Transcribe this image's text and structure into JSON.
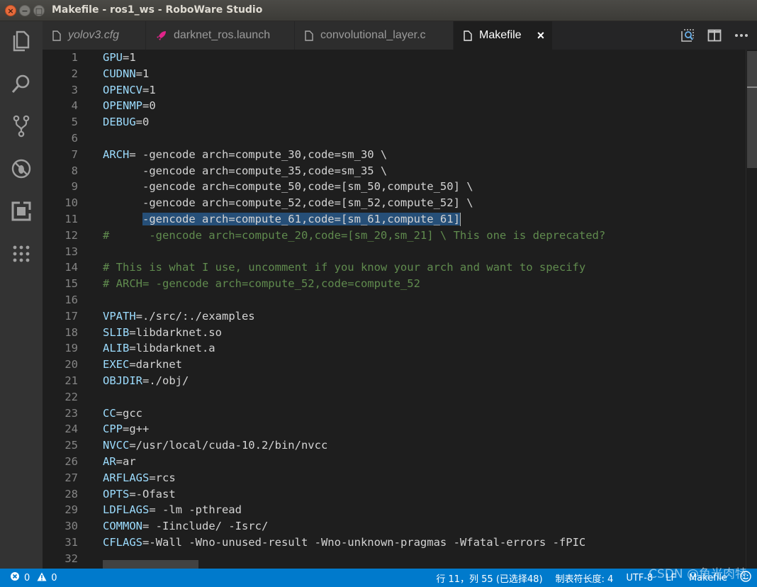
{
  "window": {
    "title": "Makefile - ros1_ws - RoboWare Studio"
  },
  "tabs": [
    {
      "label": "yolov3.cfg",
      "icon": "file-icon",
      "italic": true
    },
    {
      "label": "darknet_ros.launch",
      "icon": "rocket-icon",
      "italic": false
    },
    {
      "label": "convolutional_layer.c",
      "icon": "file-icon",
      "italic": false
    },
    {
      "label": "Makefile",
      "icon": "file-icon",
      "italic": false,
      "active": true
    }
  ],
  "tab_close": "×",
  "code": [
    {
      "n": "1",
      "t": [
        [
          "var",
          "GPU"
        ],
        [
          "txt",
          "=1"
        ]
      ]
    },
    {
      "n": "2",
      "t": [
        [
          "var",
          "CUDNN"
        ],
        [
          "txt",
          "=1"
        ]
      ]
    },
    {
      "n": "3",
      "t": [
        [
          "var",
          "OPENCV"
        ],
        [
          "txt",
          "=1"
        ]
      ]
    },
    {
      "n": "4",
      "t": [
        [
          "var",
          "OPENMP"
        ],
        [
          "txt",
          "=0"
        ]
      ]
    },
    {
      "n": "5",
      "t": [
        [
          "var",
          "DEBUG"
        ],
        [
          "txt",
          "=0"
        ]
      ]
    },
    {
      "n": "6",
      "t": []
    },
    {
      "n": "7",
      "t": [
        [
          "var",
          "ARCH"
        ],
        [
          "txt",
          "= -gencode arch=compute_30,code=sm_30 \\"
        ]
      ]
    },
    {
      "n": "8",
      "t": [
        [
          "txt",
          "      -gencode arch=compute_35,code=sm_35 \\"
        ]
      ]
    },
    {
      "n": "9",
      "t": [
        [
          "txt",
          "      -gencode arch=compute_50,code=[sm_50,compute_50] \\"
        ]
      ]
    },
    {
      "n": "10",
      "t": [
        [
          "txt",
          "      -gencode arch=compute_52,code=[sm_52,compute_52] \\"
        ]
      ]
    },
    {
      "n": "11",
      "t": [
        [
          "txt",
          "      "
        ],
        [
          "sel",
          "-gencode arch=compute_61,code=[sm_61,compute_61]"
        ],
        [
          "cursor",
          ""
        ]
      ]
    },
    {
      "n": "12",
      "t": [
        [
          "cmt",
          "#      -gencode arch=compute_20,code=[sm_20,sm_21] \\ This one is deprecated?"
        ]
      ]
    },
    {
      "n": "13",
      "t": []
    },
    {
      "n": "14",
      "t": [
        [
          "cmt",
          "# This is what I use, uncomment if you know your arch and want to specify"
        ]
      ]
    },
    {
      "n": "15",
      "t": [
        [
          "cmt",
          "# ARCH= -gencode arch=compute_52,code=compute_52"
        ]
      ]
    },
    {
      "n": "16",
      "t": []
    },
    {
      "n": "17",
      "t": [
        [
          "var",
          "VPATH"
        ],
        [
          "txt",
          "=./src/:./examples"
        ]
      ]
    },
    {
      "n": "18",
      "t": [
        [
          "var",
          "SLIB"
        ],
        [
          "txt",
          "=libdarknet.so"
        ]
      ]
    },
    {
      "n": "19",
      "t": [
        [
          "var",
          "ALIB"
        ],
        [
          "txt",
          "=libdarknet.a"
        ]
      ]
    },
    {
      "n": "20",
      "t": [
        [
          "var",
          "EXEC"
        ],
        [
          "txt",
          "=darknet"
        ]
      ]
    },
    {
      "n": "21",
      "t": [
        [
          "var",
          "OBJDIR"
        ],
        [
          "txt",
          "=./obj/"
        ]
      ]
    },
    {
      "n": "22",
      "t": []
    },
    {
      "n": "23",
      "t": [
        [
          "var",
          "CC"
        ],
        [
          "txt",
          "=gcc"
        ]
      ]
    },
    {
      "n": "24",
      "t": [
        [
          "var",
          "CPP"
        ],
        [
          "txt",
          "=g++"
        ]
      ]
    },
    {
      "n": "25",
      "t": [
        [
          "var",
          "NVCC"
        ],
        [
          "txt",
          "=/usr/local/cuda-10.2/bin/nvcc"
        ]
      ]
    },
    {
      "n": "26",
      "t": [
        [
          "var",
          "AR"
        ],
        [
          "txt",
          "=ar"
        ]
      ]
    },
    {
      "n": "27",
      "t": [
        [
          "var",
          "ARFLAGS"
        ],
        [
          "txt",
          "=rcs"
        ]
      ]
    },
    {
      "n": "28",
      "t": [
        [
          "var",
          "OPTS"
        ],
        [
          "txt",
          "=-Ofast"
        ]
      ]
    },
    {
      "n": "29",
      "t": [
        [
          "var",
          "LDFLAGS"
        ],
        [
          "txt",
          "= -lm -pthread"
        ]
      ]
    },
    {
      "n": "30",
      "t": [
        [
          "var",
          "COMMON"
        ],
        [
          "txt",
          "= -Iinclude/ -Isrc/"
        ]
      ]
    },
    {
      "n": "31",
      "t": [
        [
          "var",
          "CFLAGS"
        ],
        [
          "txt",
          "=-Wall -Wno-unused-result -Wno-unknown-pragmas -Wfatal-errors -fPIC"
        ]
      ]
    },
    {
      "n": "32",
      "t": []
    }
  ],
  "status": {
    "errors": "0",
    "warnings": "0",
    "position": "行 11，列 55 (已选择48)",
    "indent": "制表符长度: 4",
    "encoding": "UTF-8",
    "eol": "LF",
    "language": "Makefile"
  },
  "watermark": "CSDN @鱼光肉特",
  "colors": {
    "status_bar": "#007acc",
    "editor_bg": "#1e1e1e",
    "variable": "#9cdcfe",
    "comment": "#608b4e",
    "selection": "#264f78"
  }
}
